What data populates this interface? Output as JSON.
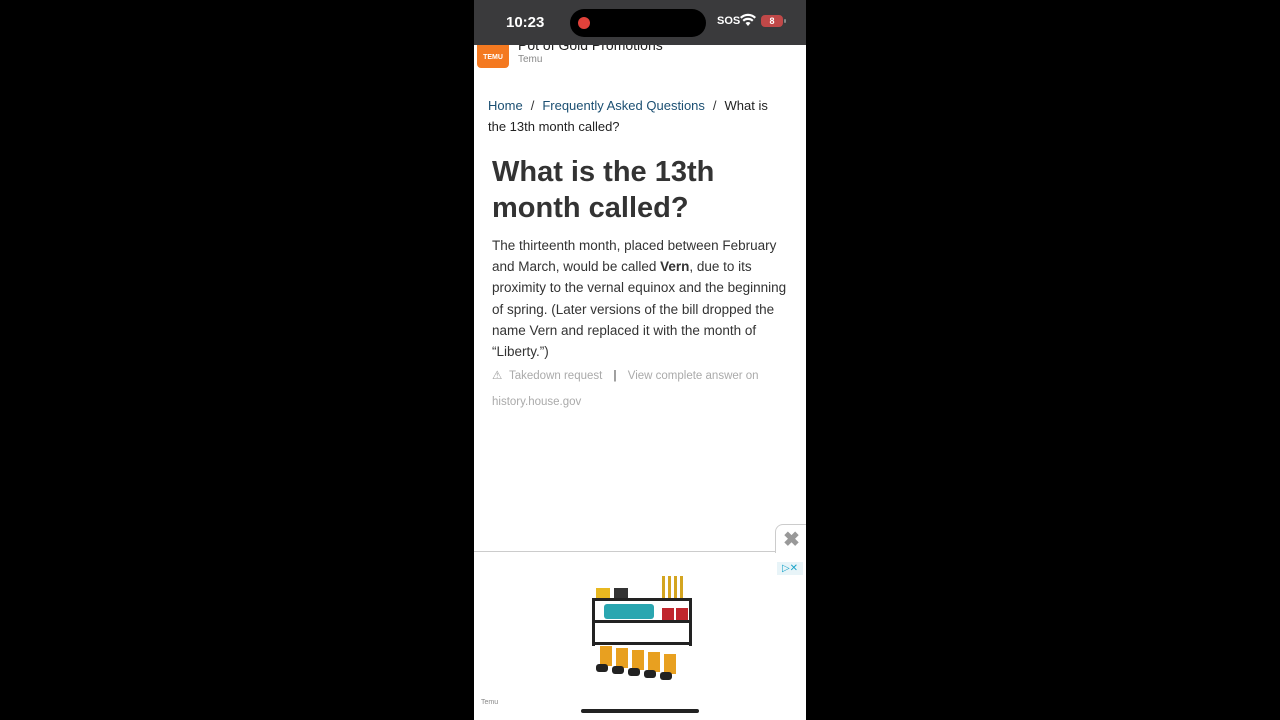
{
  "status_bar": {
    "time": "10:23",
    "sos": "SOS",
    "battery": "8"
  },
  "top_ad": {
    "logo_text": "TEMU",
    "title": "Pot of Gold Promotions",
    "advertiser": "Temu"
  },
  "breadcrumb": {
    "items": [
      "Home",
      "Frequently Asked Questions"
    ],
    "current": "What is the 13th month called?",
    "separator": "/"
  },
  "article": {
    "title": "What is the 13th month called?",
    "answer_part1": "The thirteenth month, placed between February and March, would be called ",
    "answer_bold": "Vern",
    "answer_part2": ", due to its proximity to the vernal equinox and the beginning of spring. (Later versions of the bill dropped the name Vern and replaced it with the month of “Liberty.”)",
    "takedown_label": "Takedown request",
    "meta_separator": "|",
    "view_answer_label": "View complete answer on",
    "source": "history.house.gov"
  },
  "bottom_ad": {
    "close_label": "✖",
    "adchoice_label": "▷✕",
    "advertiser": "Temu"
  },
  "colors": {
    "link": "#1b4f72",
    "temu_orange": "#f47920",
    "status_bar": "#3a3a3c"
  }
}
